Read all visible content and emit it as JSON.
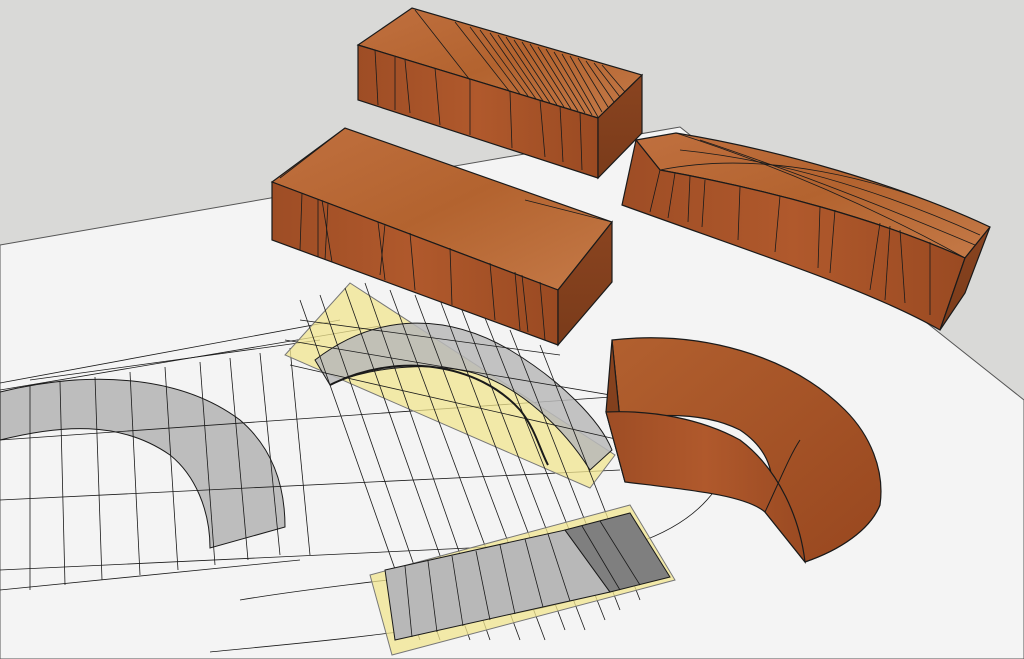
{
  "scene": {
    "description_visible_text": "",
    "objects": [
      {
        "id": "block-back",
        "kind": "rectangular-wood-block",
        "grain": "dense-kerf-cuts"
      },
      {
        "id": "block-middle",
        "kind": "rectangular-wood-block",
        "grain": "sparse-cuts"
      },
      {
        "id": "block-curved-right",
        "kind": "bent-wood-block",
        "grain": "diagonal-cuts"
      },
      {
        "id": "arch-piece",
        "kind": "curved-wood-arch-segment"
      }
    ],
    "drawings": [
      {
        "id": "arch-elevation",
        "kind": "gray-arch-band-drawing"
      },
      {
        "id": "yellow-plane-upper",
        "kind": "translucent-yellow-projection-plane"
      },
      {
        "id": "yellow-plane-lower",
        "kind": "translucent-yellow-projection-plane"
      }
    ]
  },
  "colors": {
    "background": "#d9d9d7",
    "paper": "#f4f4f4",
    "wood_top": "#b8673a",
    "wood_front": "#a8552b",
    "wood_end": "#8c4520",
    "gray_band": "#bdbdbd",
    "dark_band": "#7d7d7d",
    "yellow_plane": "#f2e68f",
    "line": "#1a1a1a"
  }
}
